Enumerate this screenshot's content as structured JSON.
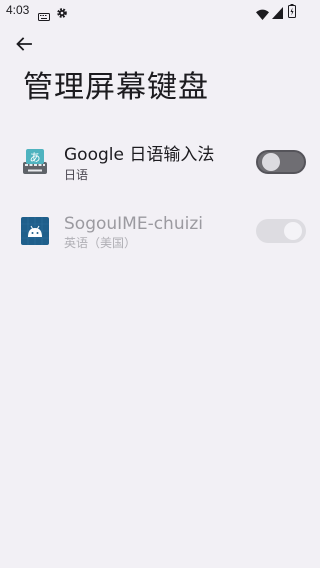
{
  "status_bar": {
    "time": "4:03",
    "icons": [
      "keyboard-icon",
      "gear-icon",
      "wifi-icon",
      "signal-icon",
      "battery-icon"
    ]
  },
  "header": {
    "back_icon": "arrow-back-icon",
    "title": "管理屏幕键盘"
  },
  "keyboards": [
    {
      "name": "Google 日语输入法",
      "language": "日语",
      "icon": "google-japanese-ime-icon",
      "enabled": false,
      "disabled_row": false
    },
    {
      "name": "SogouIME-chuizi",
      "language": "英语（美国）",
      "icon": "android-app-icon",
      "enabled": true,
      "disabled_row": true
    }
  ],
  "colors": {
    "background": "#f2f0f5",
    "text_primary": "#1c1b1f",
    "text_disabled": "#9b9aa0",
    "toggle_off_track": "#6f6e73",
    "android_icon_blue": "#1f5f8b"
  }
}
